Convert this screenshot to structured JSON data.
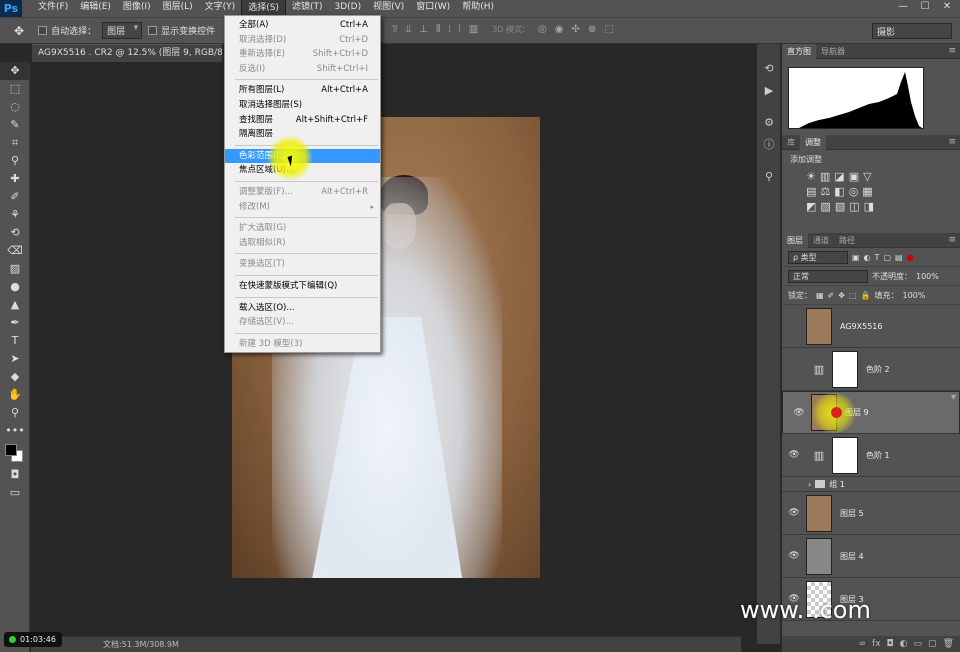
{
  "app": {
    "logo": "Ps"
  },
  "menubar": {
    "items": [
      "文件(F)",
      "编辑(E)",
      "图像(I)",
      "图层(L)",
      "文字(Y)",
      "选择(S)",
      "滤镜(T)",
      "3D(D)",
      "视图(V)",
      "窗口(W)",
      "帮助(H)"
    ],
    "active_index": 5,
    "window_controls": [
      "—",
      "☐",
      "✕"
    ]
  },
  "options": {
    "auto_select_label": "自动选择：",
    "auto_select_value": "图层",
    "show_transform_label": "显示变换控件",
    "mode_3d_label": "3D 模式：",
    "workspace_value": "摄影"
  },
  "document": {
    "tab_title": "AG9X5516 . CR2 @ 12.5% (图层 9, RGB/8) *",
    "status": "文档:51.3M/308.9M",
    "timer": "01:03:46"
  },
  "select_menu": {
    "groups": [
      [
        {
          "label": "全部(A)",
          "shortcut": "Ctrl+A",
          "enabled": true
        },
        {
          "label": "取消选择(D)",
          "shortcut": "Ctrl+D",
          "enabled": false
        },
        {
          "label": "重新选择(E)",
          "shortcut": "Shift+Ctrl+D",
          "enabled": false
        },
        {
          "label": "反选(I)",
          "shortcut": "Shift+Ctrl+I",
          "enabled": false
        }
      ],
      [
        {
          "label": "所有图层(L)",
          "shortcut": "Alt+Ctrl+A",
          "enabled": true
        },
        {
          "label": "取消选择图层(S)",
          "shortcut": "",
          "enabled": true
        },
        {
          "label": "查找图层",
          "shortcut": "Alt+Shift+Ctrl+F",
          "enabled": true
        },
        {
          "label": "隔离图层",
          "shortcut": "",
          "enabled": true
        }
      ],
      [
        {
          "label": "色彩范围(C)...",
          "shortcut": "",
          "enabled": true,
          "highlighted": true
        },
        {
          "label": "焦点区域(U)...",
          "shortcut": "",
          "enabled": true
        }
      ],
      [
        {
          "label": "调整蒙版(F)...",
          "shortcut": "Alt+Ctrl+R",
          "enabled": false
        },
        {
          "label": "修改(M)",
          "shortcut": "",
          "enabled": false,
          "submenu": true
        }
      ],
      [
        {
          "label": "扩大选取(G)",
          "shortcut": "",
          "enabled": false
        },
        {
          "label": "选取相似(R)",
          "shortcut": "",
          "enabled": false
        }
      ],
      [
        {
          "label": "变换选区(T)",
          "shortcut": "",
          "enabled": false
        }
      ],
      [
        {
          "label": "在快速蒙版模式下编辑(Q)",
          "shortcut": "",
          "enabled": true
        }
      ],
      [
        {
          "label": "载入选区(O)...",
          "shortcut": "",
          "enabled": true
        },
        {
          "label": "存储选区(V)...",
          "shortcut": "",
          "enabled": false
        }
      ],
      [
        {
          "label": "新建 3D 模型(3)",
          "shortcut": "",
          "enabled": false
        }
      ]
    ]
  },
  "panels": {
    "histogram_tabs": [
      "直方图",
      "导航器"
    ],
    "adjust_tabs": [
      "库",
      "调整"
    ],
    "adjust_label": "添加调整",
    "adjust_row1": [
      "☀",
      "▥",
      "◪",
      "▣",
      "▽"
    ],
    "adjust_row2": [
      "▤",
      "⚖",
      "◧",
      "◎",
      "▦"
    ],
    "adjust_row3": [
      "◩",
      "▨",
      "▧",
      "◫",
      "◨"
    ],
    "layers_tabs": [
      "图层",
      "通道",
      "路径"
    ],
    "filter_label": "ρ 类型",
    "blend_mode": "正常",
    "opacity_label": "不透明度：",
    "opacity_value": "100%",
    "lock_label": "锁定：",
    "fill_label": "填充：",
    "fill_value": "100%",
    "layers": [
      {
        "name": "AG9X5516",
        "thumb": "photo",
        "visible": false,
        "type": "smart"
      },
      {
        "name": "色阶 2",
        "thumb": "white",
        "visible": false,
        "type": "adjust"
      },
      {
        "name": "图层 9",
        "thumb": "photo",
        "visible": true,
        "type": "pixel",
        "selected": true
      },
      {
        "name": "色阶 1",
        "thumb": "white",
        "visible": true,
        "type": "adjust"
      },
      {
        "name": "组 1",
        "type": "group",
        "visible": true
      },
      {
        "name": "图层 5",
        "thumb": "photo",
        "visible": true,
        "type": "pixel"
      },
      {
        "name": "图层 4",
        "thumb": "gray",
        "visible": true,
        "type": "pixel"
      },
      {
        "name": "图层 3",
        "thumb": "check",
        "visible": true,
        "type": "pixel"
      }
    ],
    "bottom_icons": [
      "∞",
      "fx",
      "◘",
      "◐",
      "▭",
      "▢",
      "🗑"
    ]
  },
  "watermark": "www.   .com"
}
